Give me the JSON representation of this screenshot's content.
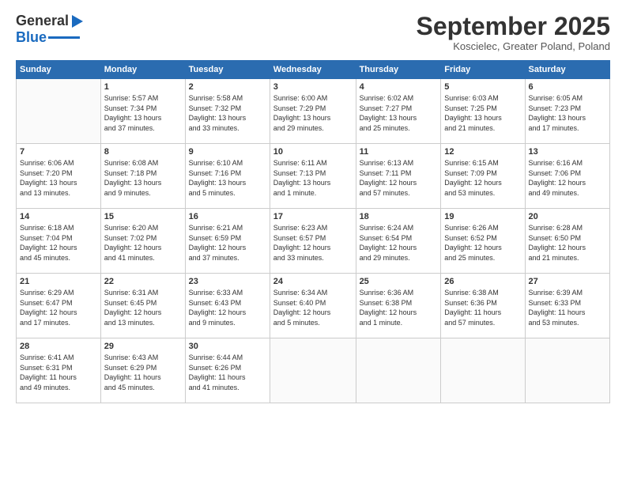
{
  "header": {
    "logo": {
      "general": "General",
      "blue": "Blue"
    },
    "title": "September 2025",
    "subtitle": "Koscielec, Greater Poland, Poland"
  },
  "weekdays": [
    "Sunday",
    "Monday",
    "Tuesday",
    "Wednesday",
    "Thursday",
    "Friday",
    "Saturday"
  ],
  "weeks": [
    [
      {
        "day": "",
        "info": ""
      },
      {
        "day": "1",
        "info": "Sunrise: 5:57 AM\nSunset: 7:34 PM\nDaylight: 13 hours\nand 37 minutes."
      },
      {
        "day": "2",
        "info": "Sunrise: 5:58 AM\nSunset: 7:32 PM\nDaylight: 13 hours\nand 33 minutes."
      },
      {
        "day": "3",
        "info": "Sunrise: 6:00 AM\nSunset: 7:29 PM\nDaylight: 13 hours\nand 29 minutes."
      },
      {
        "day": "4",
        "info": "Sunrise: 6:02 AM\nSunset: 7:27 PM\nDaylight: 13 hours\nand 25 minutes."
      },
      {
        "day": "5",
        "info": "Sunrise: 6:03 AM\nSunset: 7:25 PM\nDaylight: 13 hours\nand 21 minutes."
      },
      {
        "day": "6",
        "info": "Sunrise: 6:05 AM\nSunset: 7:23 PM\nDaylight: 13 hours\nand 17 minutes."
      }
    ],
    [
      {
        "day": "7",
        "info": "Sunrise: 6:06 AM\nSunset: 7:20 PM\nDaylight: 13 hours\nand 13 minutes."
      },
      {
        "day": "8",
        "info": "Sunrise: 6:08 AM\nSunset: 7:18 PM\nDaylight: 13 hours\nand 9 minutes."
      },
      {
        "day": "9",
        "info": "Sunrise: 6:10 AM\nSunset: 7:16 PM\nDaylight: 13 hours\nand 5 minutes."
      },
      {
        "day": "10",
        "info": "Sunrise: 6:11 AM\nSunset: 7:13 PM\nDaylight: 13 hours\nand 1 minute."
      },
      {
        "day": "11",
        "info": "Sunrise: 6:13 AM\nSunset: 7:11 PM\nDaylight: 12 hours\nand 57 minutes."
      },
      {
        "day": "12",
        "info": "Sunrise: 6:15 AM\nSunset: 7:09 PM\nDaylight: 12 hours\nand 53 minutes."
      },
      {
        "day": "13",
        "info": "Sunrise: 6:16 AM\nSunset: 7:06 PM\nDaylight: 12 hours\nand 49 minutes."
      }
    ],
    [
      {
        "day": "14",
        "info": "Sunrise: 6:18 AM\nSunset: 7:04 PM\nDaylight: 12 hours\nand 45 minutes."
      },
      {
        "day": "15",
        "info": "Sunrise: 6:20 AM\nSunset: 7:02 PM\nDaylight: 12 hours\nand 41 minutes."
      },
      {
        "day": "16",
        "info": "Sunrise: 6:21 AM\nSunset: 6:59 PM\nDaylight: 12 hours\nand 37 minutes."
      },
      {
        "day": "17",
        "info": "Sunrise: 6:23 AM\nSunset: 6:57 PM\nDaylight: 12 hours\nand 33 minutes."
      },
      {
        "day": "18",
        "info": "Sunrise: 6:24 AM\nSunset: 6:54 PM\nDaylight: 12 hours\nand 29 minutes."
      },
      {
        "day": "19",
        "info": "Sunrise: 6:26 AM\nSunset: 6:52 PM\nDaylight: 12 hours\nand 25 minutes."
      },
      {
        "day": "20",
        "info": "Sunrise: 6:28 AM\nSunset: 6:50 PM\nDaylight: 12 hours\nand 21 minutes."
      }
    ],
    [
      {
        "day": "21",
        "info": "Sunrise: 6:29 AM\nSunset: 6:47 PM\nDaylight: 12 hours\nand 17 minutes."
      },
      {
        "day": "22",
        "info": "Sunrise: 6:31 AM\nSunset: 6:45 PM\nDaylight: 12 hours\nand 13 minutes."
      },
      {
        "day": "23",
        "info": "Sunrise: 6:33 AM\nSunset: 6:43 PM\nDaylight: 12 hours\nand 9 minutes."
      },
      {
        "day": "24",
        "info": "Sunrise: 6:34 AM\nSunset: 6:40 PM\nDaylight: 12 hours\nand 5 minutes."
      },
      {
        "day": "25",
        "info": "Sunrise: 6:36 AM\nSunset: 6:38 PM\nDaylight: 12 hours\nand 1 minute."
      },
      {
        "day": "26",
        "info": "Sunrise: 6:38 AM\nSunset: 6:36 PM\nDaylight: 11 hours\nand 57 minutes."
      },
      {
        "day": "27",
        "info": "Sunrise: 6:39 AM\nSunset: 6:33 PM\nDaylight: 11 hours\nand 53 minutes."
      }
    ],
    [
      {
        "day": "28",
        "info": "Sunrise: 6:41 AM\nSunset: 6:31 PM\nDaylight: 11 hours\nand 49 minutes."
      },
      {
        "day": "29",
        "info": "Sunrise: 6:43 AM\nSunset: 6:29 PM\nDaylight: 11 hours\nand 45 minutes."
      },
      {
        "day": "30",
        "info": "Sunrise: 6:44 AM\nSunset: 6:26 PM\nDaylight: 11 hours\nand 41 minutes."
      },
      {
        "day": "",
        "info": ""
      },
      {
        "day": "",
        "info": ""
      },
      {
        "day": "",
        "info": ""
      },
      {
        "day": "",
        "info": ""
      }
    ]
  ]
}
